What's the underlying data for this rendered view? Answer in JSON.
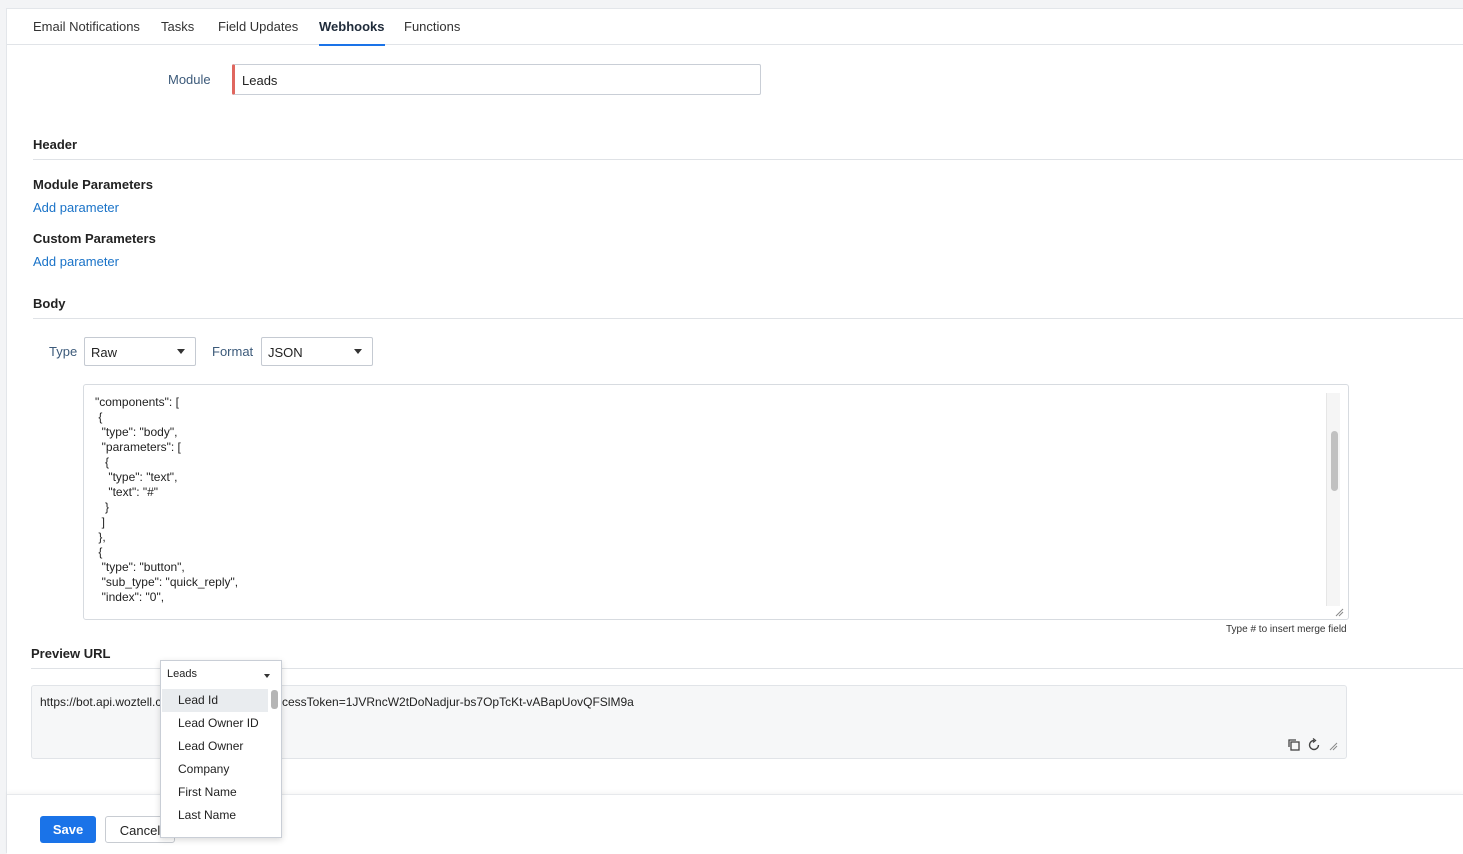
{
  "tabs": [
    {
      "label": "Email Notifications"
    },
    {
      "label": "Tasks"
    },
    {
      "label": "Field Updates"
    },
    {
      "label": "Webhooks",
      "active": true
    },
    {
      "label": "Functions"
    }
  ],
  "module": {
    "label": "Module",
    "value": "Leads"
  },
  "sections": {
    "header": "Header",
    "module_parameters": "Module Parameters",
    "custom_parameters": "Custom Parameters",
    "body": "Body",
    "preview_url": "Preview URL"
  },
  "links": {
    "add_parameter": "Add parameter"
  },
  "body": {
    "type_label": "Type",
    "type_value": "Raw",
    "format_label": "Format",
    "format_value": "JSON",
    "code_lines": [
      "   \"components\": [",
      "    {",
      "     \"type\": \"body\",",
      "     \"parameters\": [",
      "      {",
      "       \"type\": \"text\",",
      "       \"text\": \"#\"",
      "      }",
      "     ]",
      "    },",
      "    {",
      "     \"type\": \"button\",",
      "     \"sub_type\": \"quick_reply\",",
      "     \"index\": \"0\","
    ],
    "hint": "Type # to insert merge field"
  },
  "preview": {
    "url_start": "https://bot.api.woztell.c",
    "url_end": "cessToken=1JVRncW2tDoNadjur-bs7OpTcKt-vABapUovQFSlM9a"
  },
  "dropdown": {
    "selected": "Leads",
    "items": [
      "Lead Id",
      "Lead Owner ID",
      "Lead Owner",
      "Company",
      "First Name",
      "Last Name"
    ],
    "highlighted": "Lead Id"
  },
  "footer": {
    "save_label": "Save",
    "cancel_label": "Cancel"
  },
  "colors": {
    "accent": "#1a73e8",
    "link": "#1a73c8",
    "required_border": "#e0675f"
  }
}
